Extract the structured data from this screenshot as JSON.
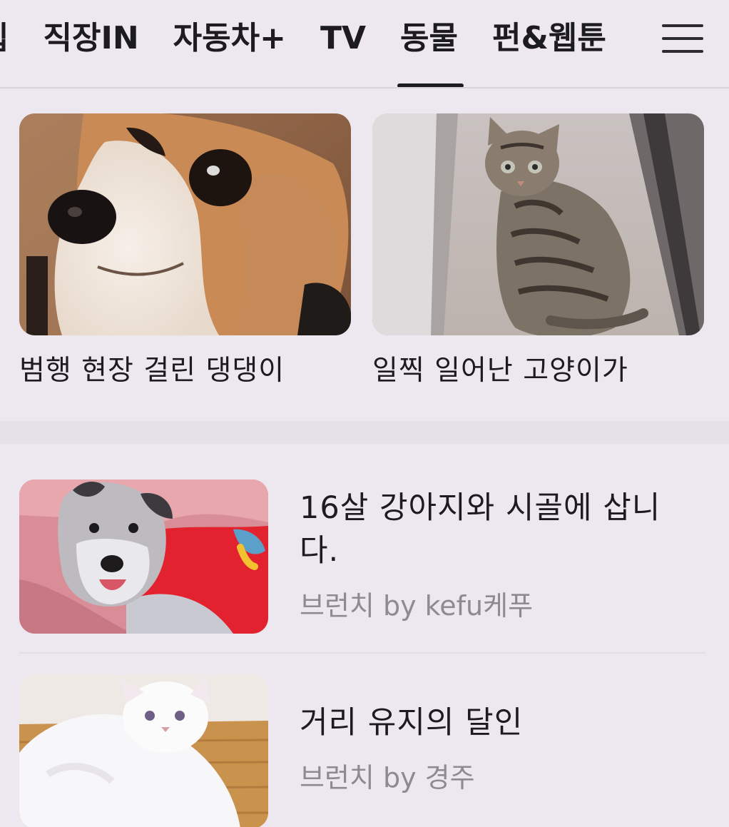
{
  "category_tabs": {
    "items": [
      "집",
      "직장IN",
      "자동차+",
      "TV",
      "동물",
      "펀&웹툰"
    ],
    "active_index": 4
  },
  "feed": {
    "cards": [
      {
        "title": "범행 현장 걸린 댕댕이"
      },
      {
        "title": "일찍 일어난 고양이가"
      }
    ],
    "list": [
      {
        "title": "16살 강아지와 시골에 삽니다.",
        "source": "브런치 by kefu케푸"
      },
      {
        "title": "거리 유지의 달인",
        "source": "브런치 by 경주"
      }
    ]
  },
  "colors": {
    "background": "#ede8ef",
    "text": "#1c1b1f",
    "subtext": "#8d8a90"
  },
  "icons": {
    "menu": "hamburger-menu-icon"
  }
}
